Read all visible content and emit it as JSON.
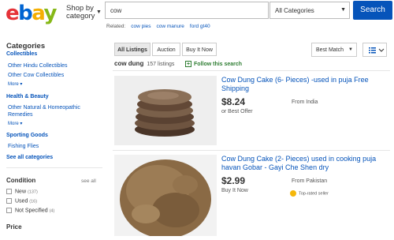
{
  "header": {
    "logo": {
      "e": "e",
      "b": "b",
      "a": "a",
      "y": "y"
    },
    "shop_by_line1": "Shop by",
    "shop_by_line2": "category",
    "search_value": "cow",
    "category_select": "All Categories",
    "search_button": "Search"
  },
  "related": {
    "label": "Related:",
    "links": [
      "cow pies",
      "cow manure",
      "ford gt40"
    ]
  },
  "sidebar": {
    "title": "Categories",
    "groups": [
      {
        "heading": "Collectibles",
        "items": [
          "Other Hindu Collectibles",
          "Other Cow Collectibles"
        ],
        "more": "More"
      },
      {
        "heading": "Health & Beauty",
        "items": [
          "Other Natural & Homeopathic",
          "Remedies"
        ],
        "more": "More"
      },
      {
        "heading": "Sporting Goods",
        "items": [
          "Fishing Flies"
        ],
        "more": ""
      }
    ],
    "see_all": "See all categories",
    "condition": {
      "title": "Condition",
      "see_all": "see all",
      "options": [
        {
          "label": "New",
          "count": "(137)"
        },
        {
          "label": "Used",
          "count": "(16)"
        },
        {
          "label": "Not Specified",
          "count": "(4)"
        }
      ]
    },
    "price_title": "Price"
  },
  "toolbar": {
    "tabs": [
      "All Listings",
      "Auction",
      "Buy It Now"
    ],
    "sort": "Best Match"
  },
  "results": {
    "query": "cow dung",
    "count": "157 listings",
    "follow": "Follow this search"
  },
  "items": [
    {
      "title": "Cow Dung Cake (6- Pieces) -used in puja Free Shipping",
      "price": "$8.24",
      "format": "or Best Offer",
      "from": "From India",
      "badge": ""
    },
    {
      "title": "Cow Dung Cake (2- Pieces) used in cooking puja havan Gobar - Gayi Che Shen dry",
      "price": "$2.99",
      "format": "Buy It Now",
      "from": "From Pakistan",
      "badge": "Top-rated seller"
    }
  ],
  "colors": {
    "link": "#0654ba",
    "search_button": "#0654ba",
    "follow": "#2e7d32"
  },
  "icons": [
    "chevron-down-icon",
    "list-view-icon",
    "plus-icon",
    "top-rated-icon"
  ]
}
